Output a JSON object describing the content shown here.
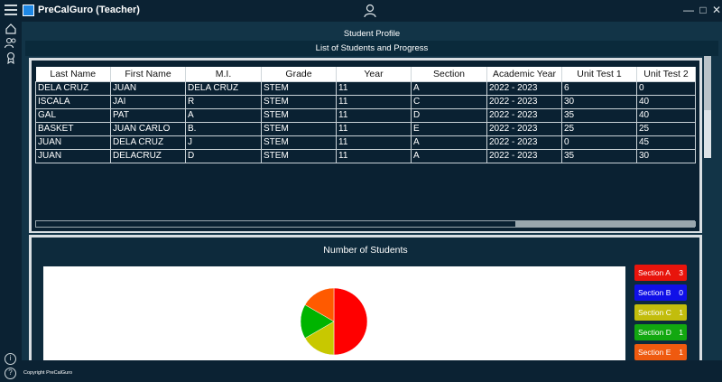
{
  "window": {
    "title": "PreCalGuro (Teacher)",
    "minimize": "—",
    "maximize": "□",
    "close": "✕"
  },
  "page": {
    "title": "Student Profile",
    "list_title": "List of Students and Progress"
  },
  "table": {
    "headers": [
      "Last Name",
      "First Name",
      "M.I.",
      "Grade",
      "Year",
      "Section",
      "Academic Year",
      "Unit Test 1",
      "Unit Test 2"
    ],
    "rows": [
      [
        "DELA CRUZ",
        "JUAN",
        "DELA CRUZ",
        "STEM",
        "11",
        "A",
        "2022 - 2023",
        "6",
        "0"
      ],
      [
        "ISCALA",
        "JAI",
        "R",
        "STEM",
        "11",
        "C",
        "2022 - 2023",
        "30",
        "40"
      ],
      [
        "GAL",
        "PAT",
        "A",
        "STEM",
        "11",
        "D",
        "2022 - 2023",
        "35",
        "40"
      ],
      [
        "BASKET",
        "JUAN CARLO",
        "B.",
        "STEM",
        "11",
        "E",
        "2022 - 2023",
        "25",
        "25"
      ],
      [
        "JUAN",
        "DELA CRUZ",
        "J",
        "STEM",
        "11",
        "A",
        "2022 - 2023",
        "0",
        "45"
      ],
      [
        "JUAN",
        "DELACRUZ",
        "D",
        "STEM",
        "11",
        "A",
        "2022 - 2023",
        "35",
        "30"
      ]
    ]
  },
  "chart_data": {
    "type": "pie",
    "title": "Number of Students",
    "categories": [
      "Section A",
      "Section B",
      "Section C",
      "Section D",
      "Section E"
    ],
    "values": [
      3,
      0,
      1,
      1,
      1
    ],
    "colors": [
      "#ff0000",
      "#0000ff",
      "#c8c800",
      "#00b400",
      "#ff5a00"
    ]
  },
  "legend_colors": [
    "#e8140c",
    "#1010e8",
    "#c2bd0c",
    "#12a810",
    "#ef5a0f"
  ],
  "footer": {
    "copyright": "Copyright PreCalGuro"
  }
}
